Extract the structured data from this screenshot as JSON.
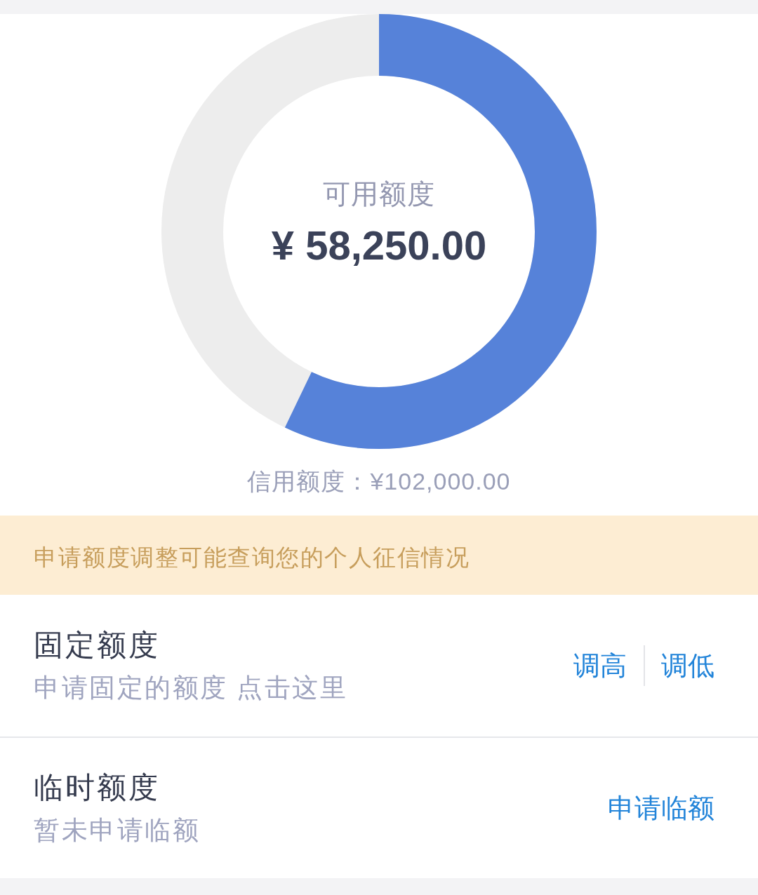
{
  "gauge": {
    "label": "可用额度",
    "amount": "¥ 58,250.00",
    "level": 0.571
  },
  "credit_line": "信用额度：¥102,000.00",
  "notice": "申请额度调整可能查询您的个人征信情况",
  "sections": [
    {
      "title": "固定额度",
      "subtitle": "申请固定的额度 点击这里",
      "actions": [
        "调高",
        "调低"
      ]
    },
    {
      "title": "临时额度",
      "subtitle": "暂未申请临额",
      "actions": [
        "申请临额"
      ]
    }
  ]
}
